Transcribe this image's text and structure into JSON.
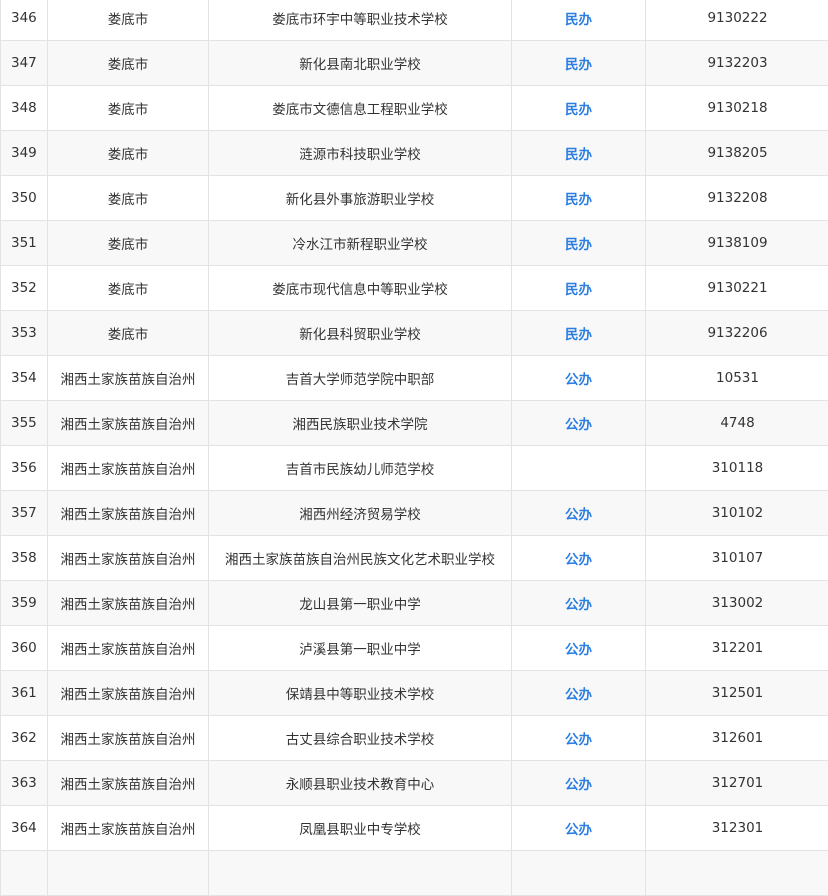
{
  "rows": [
    {
      "no": "346",
      "city": "娄底市",
      "school": "娄底市环宇中等职业技术学校",
      "type": "民办",
      "code": "9130222"
    },
    {
      "no": "347",
      "city": "娄底市",
      "school": "新化县南北职业学校",
      "type": "民办",
      "code": "9132203"
    },
    {
      "no": "348",
      "city": "娄底市",
      "school": "娄底市文德信息工程职业学校",
      "type": "民办",
      "code": "9130218"
    },
    {
      "no": "349",
      "city": "娄底市",
      "school": "涟源市科技职业学校",
      "type": "民办",
      "code": "9138205"
    },
    {
      "no": "350",
      "city": "娄底市",
      "school": "新化县外事旅游职业学校",
      "type": "民办",
      "code": "9132208"
    },
    {
      "no": "351",
      "city": "娄底市",
      "school": "冷水江市新程职业学校",
      "type": "民办",
      "code": "9138109"
    },
    {
      "no": "352",
      "city": "娄底市",
      "school": "娄底市现代信息中等职业学校",
      "type": "民办",
      "code": "9130221"
    },
    {
      "no": "353",
      "city": "娄底市",
      "school": "新化县科贸职业学校",
      "type": "民办",
      "code": "9132206"
    },
    {
      "no": "354",
      "city": "湘西土家族苗族自治州",
      "school": "吉首大学师范学院中职部",
      "type": "公办",
      "code": "10531"
    },
    {
      "no": "355",
      "city": "湘西土家族苗族自治州",
      "school": "湘西民族职业技术学院",
      "type": "公办",
      "code": "4748"
    },
    {
      "no": "356",
      "city": "湘西土家族苗族自治州",
      "school": "吉首市民族幼儿师范学校",
      "type": "",
      "code": "310118"
    },
    {
      "no": "357",
      "city": "湘西土家族苗族自治州",
      "school": "湘西州经济贸易学校",
      "type": "公办",
      "code": "310102"
    },
    {
      "no": "358",
      "city": "湘西土家族苗族自治州",
      "school": "湘西土家族苗族自治州民族文化艺术职业学校",
      "type": "公办",
      "code": "310107"
    },
    {
      "no": "359",
      "city": "湘西土家族苗族自治州",
      "school": "龙山县第一职业中学",
      "type": "公办",
      "code": "313002"
    },
    {
      "no": "360",
      "city": "湘西土家族苗族自治州",
      "school": "泸溪县第一职业中学",
      "type": "公办",
      "code": "312201"
    },
    {
      "no": "361",
      "city": "湘西土家族苗族自治州",
      "school": "保靖县中等职业技术学校",
      "type": "公办",
      "code": "312501"
    },
    {
      "no": "362",
      "city": "湘西土家族苗族自治州",
      "school": "古丈县综合职业技术学校",
      "type": "公办",
      "code": "312601"
    },
    {
      "no": "363",
      "city": "湘西土家族苗族自治州",
      "school": "永顺县职业技术教育中心",
      "type": "公办",
      "code": "312701"
    },
    {
      "no": "364",
      "city": "湘西土家族苗族自治州",
      "school": "凤凰县职业中专学校",
      "type": "公办",
      "code": "312301"
    },
    {
      "no": "",
      "city": "",
      "school": "",
      "type": "",
      "code": ""
    }
  ]
}
